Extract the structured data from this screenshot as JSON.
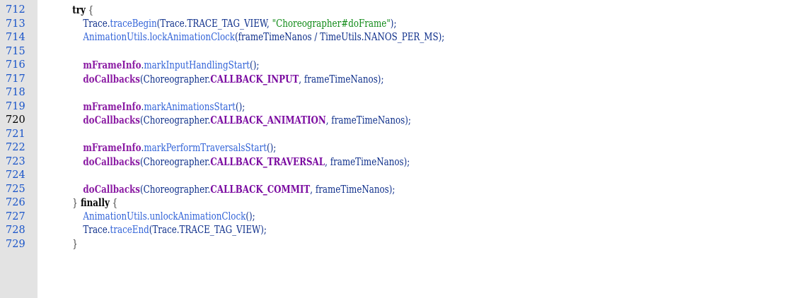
{
  "editor": {
    "line_numbers": [
      "712",
      "713",
      "714",
      "715",
      "716",
      "717",
      "718",
      "719",
      "720",
      "721",
      "722",
      "723",
      "724",
      "725",
      "726",
      "727",
      "728",
      "729"
    ],
    "current_line_index": 8,
    "lines": [
      [
        {
          "t": "        ",
          "c": "plain"
        },
        {
          "t": "try",
          "c": "kw"
        },
        {
          "t": " {",
          "c": "brace"
        }
      ],
      [
        {
          "t": "            ",
          "c": "plain"
        },
        {
          "t": "Trace.",
          "c": "plain"
        },
        {
          "t": "traceBegin",
          "c": "fn"
        },
        {
          "t": "(Trace.TRACE_TAG_VIEW, ",
          "c": "plain"
        },
        {
          "t": "\"Choreographer#doFrame\"",
          "c": "str"
        },
        {
          "t": ");",
          "c": "plain"
        }
      ],
      [
        {
          "t": "            ",
          "c": "plain"
        },
        {
          "t": "AnimationUtils.",
          "c": "fn"
        },
        {
          "t": "lockAnimationClock",
          "c": "fn"
        },
        {
          "t": "(frameTimeNanos / TimeUtils.NANOS_PER_MS);",
          "c": "plain"
        }
      ],
      [],
      [
        {
          "t": "            ",
          "c": "plain"
        },
        {
          "t": "mFrameInfo",
          "c": "mem"
        },
        {
          "t": ".",
          "c": "plain"
        },
        {
          "t": "markInputHandlingStart",
          "c": "fn"
        },
        {
          "t": "();",
          "c": "plain"
        }
      ],
      [
        {
          "t": "            ",
          "c": "plain"
        },
        {
          "t": "doCallbacks",
          "c": "mem"
        },
        {
          "t": "(Choreographer.",
          "c": "plain"
        },
        {
          "t": "CALLBACK_INPUT",
          "c": "const"
        },
        {
          "t": ", frameTimeNanos);",
          "c": "plain"
        }
      ],
      [],
      [
        {
          "t": "            ",
          "c": "plain"
        },
        {
          "t": "mFrameInfo",
          "c": "mem"
        },
        {
          "t": ".",
          "c": "plain"
        },
        {
          "t": "markAnimationsStart",
          "c": "fn"
        },
        {
          "t": "();",
          "c": "plain"
        }
      ],
      [
        {
          "t": "            ",
          "c": "plain"
        },
        {
          "t": "doCallbacks",
          "c": "mem"
        },
        {
          "t": "(Choreographer.",
          "c": "plain"
        },
        {
          "t": "CALLBACK_ANIMATION",
          "c": "const"
        },
        {
          "t": ", frameTimeNanos);",
          "c": "plain"
        }
      ],
      [],
      [
        {
          "t": "            ",
          "c": "plain"
        },
        {
          "t": "mFrameInfo",
          "c": "mem"
        },
        {
          "t": ".",
          "c": "plain"
        },
        {
          "t": "markPerformTraversalsStart",
          "c": "fn"
        },
        {
          "t": "();",
          "c": "plain"
        }
      ],
      [
        {
          "t": "            ",
          "c": "plain"
        },
        {
          "t": "doCallbacks",
          "c": "mem"
        },
        {
          "t": "(Choreographer.",
          "c": "plain"
        },
        {
          "t": "CALLBACK_TRAVERSAL",
          "c": "const"
        },
        {
          "t": ", frameTimeNanos);",
          "c": "plain"
        }
      ],
      [],
      [
        {
          "t": "            ",
          "c": "plain"
        },
        {
          "t": "doCallbacks",
          "c": "mem"
        },
        {
          "t": "(Choreographer.",
          "c": "plain"
        },
        {
          "t": "CALLBACK_COMMIT",
          "c": "const"
        },
        {
          "t": ", frameTimeNanos);",
          "c": "plain"
        }
      ],
      [
        {
          "t": "        ",
          "c": "plain"
        },
        {
          "t": "}",
          "c": "brace"
        },
        {
          "t": " finally",
          "c": "kw"
        },
        {
          "t": " {",
          "c": "brace"
        }
      ],
      [
        {
          "t": "            ",
          "c": "plain"
        },
        {
          "t": "AnimationUtils.",
          "c": "fn"
        },
        {
          "t": "unlockAnimationClock",
          "c": "fn"
        },
        {
          "t": "();",
          "c": "plain"
        }
      ],
      [
        {
          "t": "            ",
          "c": "plain"
        },
        {
          "t": "Trace.",
          "c": "plain"
        },
        {
          "t": "traceEnd",
          "c": "fn"
        },
        {
          "t": "(Trace.TRACE_TAG_VIEW);",
          "c": "plain"
        }
      ],
      [
        {
          "t": "        ",
          "c": "plain"
        },
        {
          "t": "}",
          "c": "brace"
        }
      ]
    ]
  },
  "colors": {
    "gutter_bg": "#e3e3e3",
    "line_number": "#1a55c9",
    "keyword": "#000000",
    "member": "#8a1aa3",
    "constant": "#7a0aa0",
    "string": "#0f8a16",
    "function": "#3062d8"
  }
}
